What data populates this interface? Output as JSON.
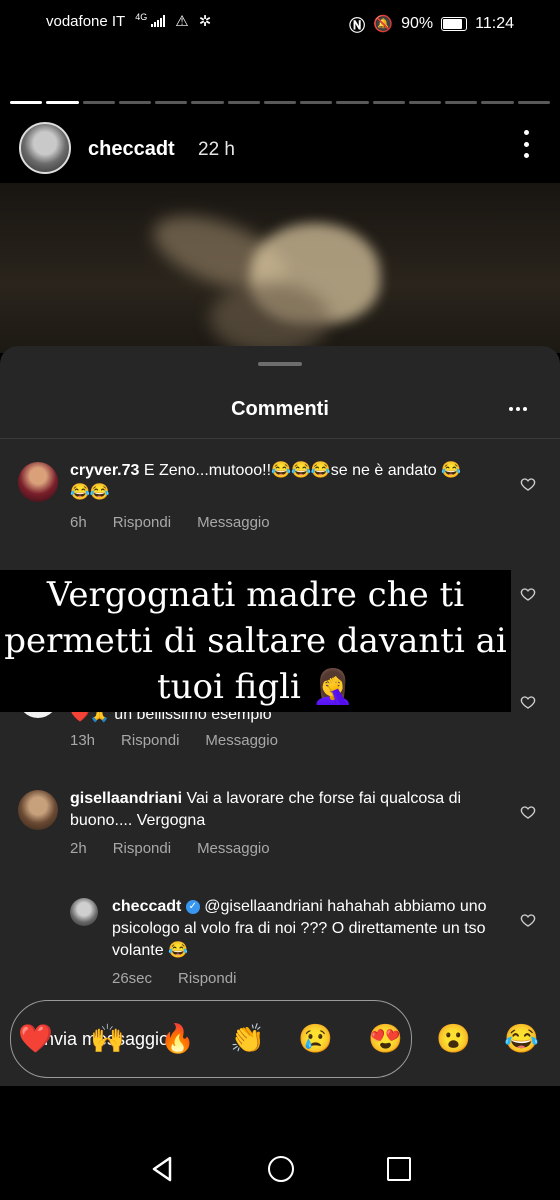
{
  "status_bar": {
    "carrier": "vodafone IT",
    "network_type": "4G",
    "battery": "90%",
    "time": "11:24"
  },
  "story": {
    "progress": {
      "total_segments": 15,
      "current_segment": 2
    },
    "username": "checcadt",
    "time_ago": "22 h"
  },
  "comments_sheet": {
    "title": "Commenti",
    "comments": [
      {
        "user": "cryver.73",
        "text": "E Zeno...mutooo!!😂😂😂se ne è andato 😂😂😂",
        "time": "6h",
        "reply": "Rispondi",
        "message": "Messaggio"
      },
      {
        "user": "",
        "text": "❤️🙏 un bellissimo esempio",
        "time": "13h",
        "reply": "Rispondi",
        "message": "Messaggio"
      },
      {
        "user": "gisellaandriani",
        "text": "Vai a lavorare che forse fai qualcosa di  buono.... Vergogna",
        "time": "2h",
        "reply": "Rispondi",
        "message": "Messaggio"
      },
      {
        "user": "checcadt",
        "verified": true,
        "text": "@gisellaandriani hahahah abbiamo uno psicologo al volo fra di noi ??? O direttamente un tso volante 😂",
        "time": "26sec",
        "reply": "Rispondi"
      }
    ]
  },
  "overlay_caption": {
    "line1": "Vergognati madre che ti",
    "line2": "permetti di saltare davanti ai",
    "line3": "tuoi figli 🤦‍♀️"
  },
  "input": {
    "placeholder": "Invia messaggio",
    "reactions": [
      "❤️",
      "🙌",
      "🔥",
      "👏",
      "😢",
      "😍",
      "😮",
      "😂"
    ]
  },
  "colors": {
    "sheet_bg": "#262626",
    "meta_gray": "#a8a8a8",
    "verified_blue": "#3897f0"
  }
}
